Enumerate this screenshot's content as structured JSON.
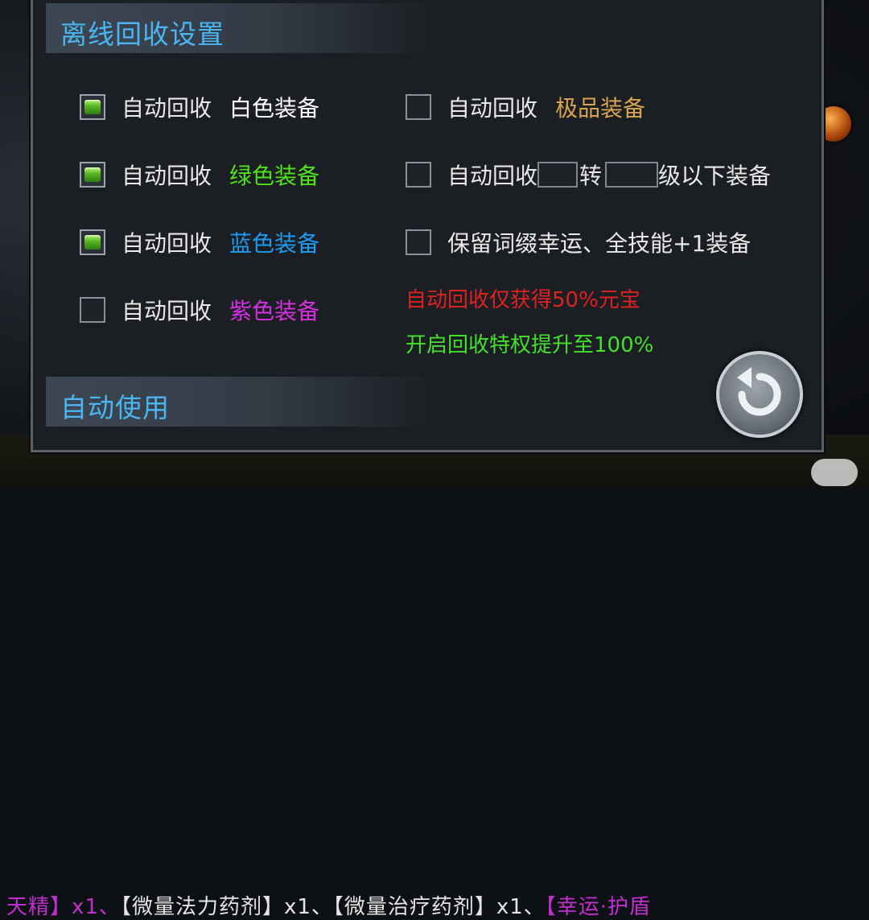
{
  "window": {
    "title": "离线回收设置"
  },
  "sections": {
    "recycle_title": "离线回收设置",
    "auto_use_title": "自动使用"
  },
  "left_options": [
    {
      "prefix": "自动回收",
      "gear": "白色装备",
      "gear_color": "#ffffff",
      "checked": true
    },
    {
      "prefix": "自动回收",
      "gear": "绿色装备",
      "gear_color": "#4ee11c",
      "checked": true
    },
    {
      "prefix": "自动回收",
      "gear": "蓝色装备",
      "gear_color": "#1e9bf0",
      "checked": true
    },
    {
      "prefix": "自动回收",
      "gear": "紫色装备",
      "gear_color": "#d531e0",
      "checked": false
    }
  ],
  "right_options": [
    {
      "prefix": "自动回收",
      "gear": "极品装备",
      "gear_color": "#d9a452",
      "checked": false
    },
    {
      "prefix": "自动回收",
      "mid": "转",
      "suffix": "级以下装备",
      "checked": false
    },
    {
      "label": "保留词缀幸运、全技能+1装备",
      "checked": false
    }
  ],
  "notes": {
    "warning": "自动回收仅获得50%元宝",
    "warning_color": "#e02121",
    "privilege": "开启回收特权提升至100%",
    "privilege_color": "#43e02d"
  },
  "background_chat": {
    "seg1": "天精】x1、",
    "seg2": "【微量法力药剂】x1、【微量治疗药剂】x1、",
    "seg3": "【幸运·护盾"
  },
  "icons": [
    "checkbox-checked",
    "checkbox-empty",
    "back-arrow-icon",
    "chat-icon"
  ]
}
